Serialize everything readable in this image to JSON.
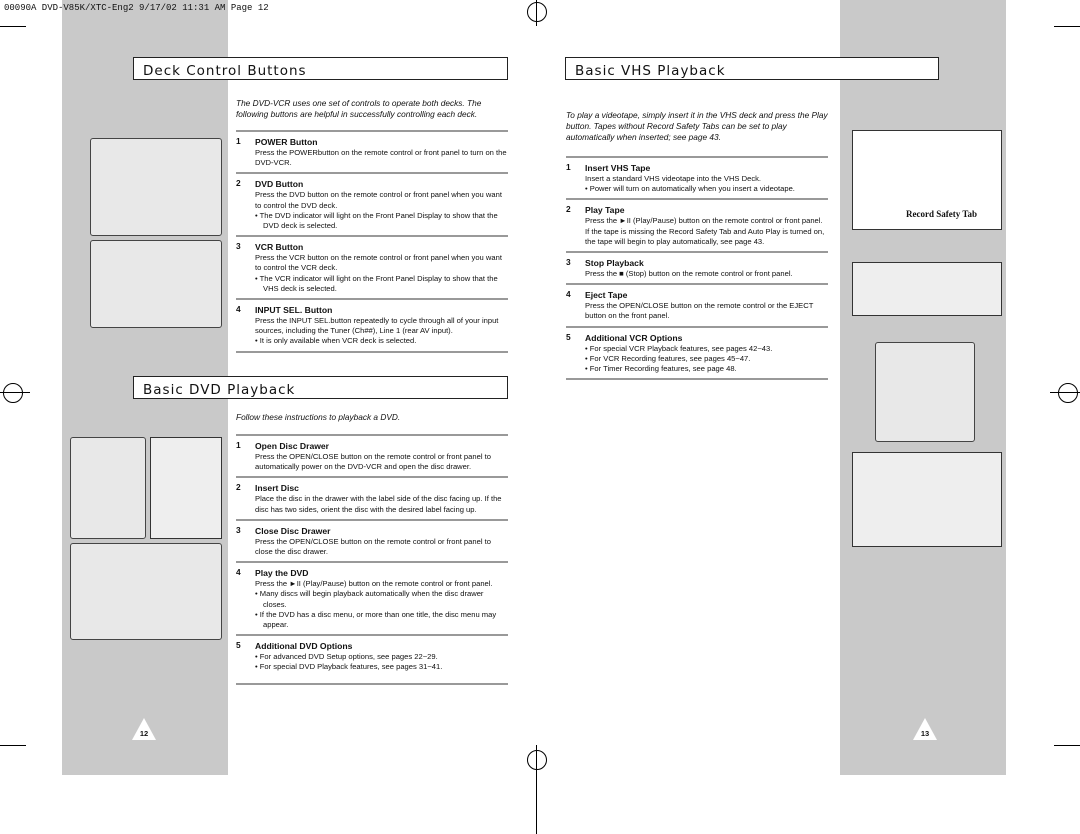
{
  "slug": "00090A DVD-V85K/XTC-Eng2  9/17/02 11:31 AM  Page 12",
  "left": {
    "deck": {
      "title": "Deck Control Buttons",
      "intro": "The DVD-VCR uses one set of controls to operate both decks. The following buttons are helpful in successfully controlling each deck.",
      "items": [
        {
          "n": "1",
          "h": "POWER Button",
          "p": "Press the POWERbutton on the remote control or front panel to turn on the DVD-VCR.",
          "b": []
        },
        {
          "n": "2",
          "h": "DVD Button",
          "p": "Press the DVD button on the remote control or front panel when you want to control the DVD deck.",
          "b": [
            "• The DVD indicator will light on the Front Panel Display to show that the DVD deck is selected."
          ]
        },
        {
          "n": "3",
          "h": "VCR Button",
          "p": "Press the VCR button on the remote control or front panel when you want to control the VCR deck.",
          "b": [
            "• The VCR indicator will light on the Front Panel Display to show that the VHS deck is selected."
          ]
        },
        {
          "n": "4",
          "h": "INPUT SEL. Button",
          "p": "Press the INPUT SEL.button repeatedly to cycle through all of your input sources, including the  Tuner (Ch##), Line 1 (rear AV input).",
          "b": [
            "• It is only available when VCR deck is selected."
          ]
        }
      ]
    },
    "dvd": {
      "title": "Basic DVD Playback",
      "intro": "Follow these instructions to playback a DVD.",
      "items": [
        {
          "n": "1",
          "h": "Open Disc Drawer",
          "p": "Press the OPEN/CLOSE button on the remote control or front panel to automatically power on the DVD-VCR and open the disc drawer.",
          "b": []
        },
        {
          "n": "2",
          "h": "Insert Disc",
          "p": "Place the disc in the drawer with the label side of the disc facing up. If the disc has two sides, orient the disc with the desired label facing up.",
          "b": []
        },
        {
          "n": "3",
          "h": "Close Disc Drawer",
          "p": "Press the OPEN/CLOSE button on the remote control or front panel to close the disc drawer.",
          "b": []
        },
        {
          "n": "4",
          "h": "Play the DVD",
          "p": "Press the ►II (Play/Pause) button on the remote control or front panel.",
          "b": [
            "• Many discs will begin playback automatically when the disc drawer closes.",
            "• If the DVD has a disc menu, or more than one title, the disc menu may appear."
          ]
        },
        {
          "n": "5",
          "h": "Additional DVD Options",
          "p": "",
          "b": [
            "• For advanced DVD Setup options, see pages 22~29.",
            "• For special DVD Playback features, see pages 31~41."
          ]
        }
      ]
    },
    "page": "12"
  },
  "right": {
    "vhs": {
      "title": "Basic VHS Playback",
      "intro": "To play a videotape, simply insert it in the VHS deck and press the Play button. Tapes without Record Safety Tabs can be set to play automatically when inserted; see page 43.",
      "items": [
        {
          "n": "1",
          "h": "Insert VHS Tape",
          "p": "Insert a standard VHS videotape into the VHS Deck.",
          "b": [
            "• Power will turn on automatically when you insert a videotape."
          ]
        },
        {
          "n": "2",
          "h": "Play Tape",
          "p": "Press the ►II (Play/Pause) button on the remote control or front panel. If  the tape is missing the Record Safety Tab and Auto Play is turned on, the tape will begin to play automatically, see page 43.",
          "b": []
        },
        {
          "n": "3",
          "h": "Stop Playback",
          "p": "Press the ■ (Stop) button on the remote control or front panel.",
          "b": []
        },
        {
          "n": "4",
          "h": "Eject Tape",
          "p": "Press the OPEN/CLOSE button on the remote control or the EJECT button on the front panel.",
          "b": []
        },
        {
          "n": "5",
          "h": "Additional VCR Options",
          "p": "",
          "b": [
            "• For special VCR Playback features, see pages 42~43.",
            "• For VCR Recording features, see pages 45~47.",
            "• For Timer Recording features, see page 48."
          ]
        }
      ]
    },
    "tab_label": "Record Safety Tab",
    "page": "13"
  }
}
